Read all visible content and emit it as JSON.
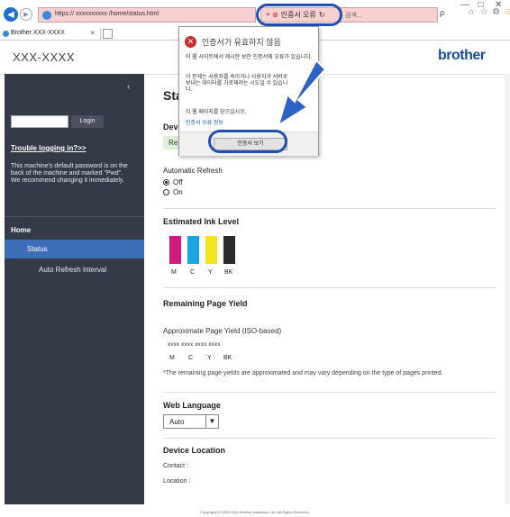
{
  "browser": {
    "url": "https:// xxxxxxxxxx /home/status.html",
    "cert_error": "인증서 오류",
    "address_rest": "검색...",
    "tab_title": "Brother XXX-XXXX",
    "tab_close": "×",
    "win_min": "—",
    "win_max": "☐",
    "win_close": "✕",
    "search_icon": "ρ",
    "toolbar_icons": [
      "⌂",
      "☆",
      "⚙"
    ]
  },
  "header": {
    "model": "XXX-XXXX",
    "brand": "brother"
  },
  "sidebar": {
    "collapse": "‹",
    "login_label": "Login",
    "trouble": "Trouble logging in?>>",
    "password_note": "This machine's default password is on the back of the machine and marked \"Pwd\".\nWe recommend changing it immediately.",
    "home": "Home",
    "status": "Status",
    "auto_refresh_interval": "Auto Refresh Interval"
  },
  "main": {
    "status_title": "Sta",
    "device_status_heading": "Devi",
    "device_status_value": "Re",
    "auto_refresh_label": "Automatic Refresh",
    "radio_off": "Off",
    "radio_on": "On",
    "ink_heading": "Estimated Ink Level",
    "ink": [
      {
        "label": "M",
        "color": "#d0197c"
      },
      {
        "label": "C",
        "color": "#1aa4e0"
      },
      {
        "label": "Y",
        "color": "#f4e51a"
      },
      {
        "label": "BK",
        "color": "#2a2a2a"
      }
    ],
    "yield_heading": "Remaining Page Yield",
    "yield_label": "Approximate Page Yield (ISO-based)",
    "yield_values": "xxxx  xxxx  xxxx  xxxx",
    "yield_cols": [
      "M",
      "C",
      "Y",
      "BK"
    ],
    "yield_note": "*The remaining page yields are approximated and may vary depending on the type of pages printed.",
    "lang_heading": "Web Language",
    "lang_value": "Auto",
    "lang_arrow": "▼",
    "location_heading": "Device Location",
    "contact": "Contact :",
    "location": "Location :"
  },
  "popup": {
    "title": "인증서가 유효하지 않음",
    "body1": "이 웹 사이트에서 제시한 보안 인증서에 오류가 있습니다.",
    "body2": "이 문제는 사용자를 속이거나 사용자가 서버로 보내는 데이터를 가로채려는 시도일 수 있습니다.",
    "body3": "이 웹 페이지를 닫으십시오.",
    "link": "인증서 오류 정보",
    "view_button": "인증서 보기",
    "error_glyph": "✕"
  },
  "footer": "Copyright(C) 2000-2021 Brother Industries, Ltd. All Rights Reserved."
}
